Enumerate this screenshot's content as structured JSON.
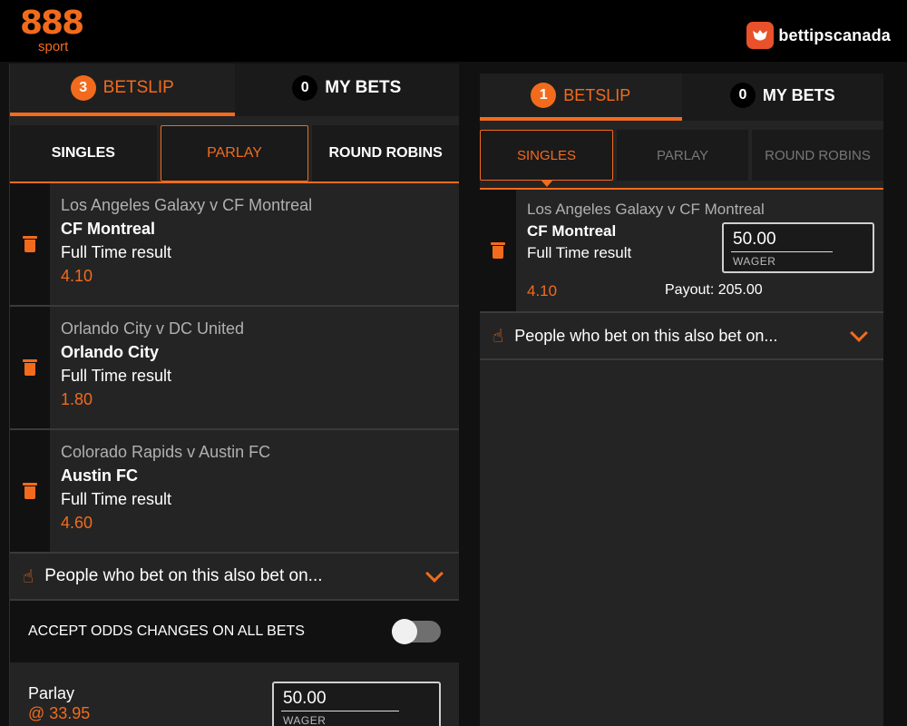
{
  "header": {
    "brand_number": "888",
    "brand_sub": "sport",
    "partner_name": "bettipscanada"
  },
  "left": {
    "tabs": [
      {
        "label": "BETSLIP",
        "count": "3"
      },
      {
        "label": "MY BETS",
        "count": "0"
      }
    ],
    "subtabs": [
      "SINGLES",
      "PARLAY",
      "ROUND ROBINS"
    ],
    "bets": [
      {
        "match": "Los Angeles Galaxy v CF Montreal",
        "selection": "CF Montreal",
        "market": "Full Time result",
        "odds": "4.10"
      },
      {
        "match": "Orlando City v DC United",
        "selection": "Orlando City",
        "market": "Full Time result",
        "odds": "1.80"
      },
      {
        "match": "Colorado Rapids v Austin FC",
        "selection": "Austin FC",
        "market": "Full Time result",
        "odds": "4.60"
      }
    ],
    "people_text": "People who bet on this also bet on...",
    "accept_text": "ACCEPT ODDS CHANGES ON ALL BETS",
    "parlay_label": "Parlay",
    "parlay_odds": "@ 33.95",
    "parlay_wager": "50.00",
    "wager_label": "WAGER"
  },
  "right": {
    "tabs": [
      {
        "label": "BETSLIP",
        "count": "1"
      },
      {
        "label": "MY BETS",
        "count": "0"
      }
    ],
    "subtabs": [
      "SINGLES",
      "PARLAY",
      "ROUND ROBINS"
    ],
    "bet": {
      "match": "Los Angeles Galaxy v CF Montreal",
      "selection": "CF Montreal",
      "market": "Full Time result",
      "odds": "4.10",
      "wager": "50.00",
      "wager_label": "WAGER",
      "payout": "Payout: 205.00"
    },
    "people_text": "People who bet on this also bet on..."
  },
  "icons": {
    "trash": "trash-icon",
    "thumb": "thumbs-up-icon",
    "chevron": "chevron-down-icon",
    "partner": "fox-logo-icon"
  },
  "colors": {
    "accent": "#f26b1d",
    "background": "#242424",
    "topbar": "#000000"
  }
}
